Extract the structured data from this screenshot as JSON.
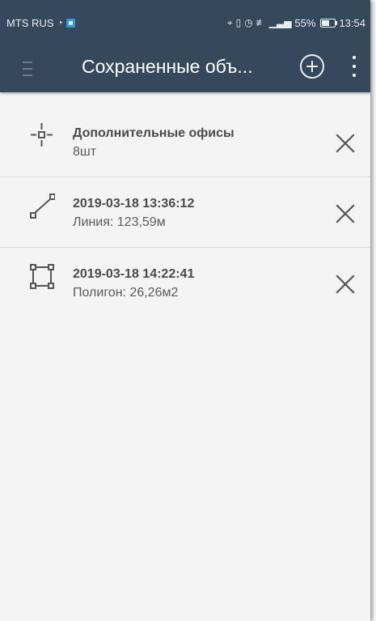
{
  "status_bar": {
    "carrier": "MTS RUS",
    "battery_percent": "55%",
    "battery_level": 0.55,
    "time": "13:54",
    "icons": [
      "vpn-icon",
      "shield-app-icon",
      "location-icon",
      "vibrate-icon",
      "alarm-icon",
      "wifi-icon",
      "signal-icon",
      "battery-icon"
    ]
  },
  "app_bar": {
    "title": "Сохраненные объ...",
    "icons": {
      "menu": "hamburger-icon",
      "add": "add-circle-icon",
      "more": "more-vert-icon"
    }
  },
  "items": [
    {
      "title": "Дополнительные офисы",
      "subtitle": "8шт",
      "icon": "point-icon"
    },
    {
      "title": "2019-03-18 13:36:12",
      "subtitle": "Линия: 123,59м",
      "icon": "line-icon"
    },
    {
      "title": "2019-03-18 14:22:41",
      "subtitle": "Полигон: 26,26м2",
      "icon": "polygon-icon"
    }
  ],
  "colors": {
    "app_bar": "#36495c",
    "background": "#f4f4f4",
    "title_text": "#4a4a4a",
    "icon": "#555555"
  }
}
